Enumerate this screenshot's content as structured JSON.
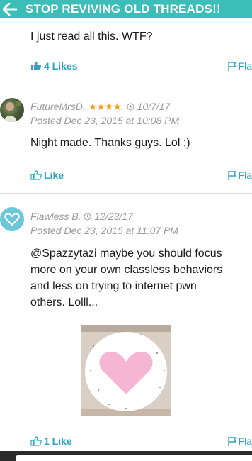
{
  "header": {
    "title": "STOP REVIVING OLD THREADS!!"
  },
  "post0": {
    "text": "I just read all this. WTF?",
    "like_label": "4 Likes",
    "flag_label": "Fla"
  },
  "post1": {
    "username": "FutureMrsD.",
    "stars": "★★★★",
    "date": "10/7/17",
    "posted": "Posted Dec 23, 2015 at 10:08 PM",
    "text": "Night made. Thanks guys. Lol :)",
    "like_label": "Like",
    "flag_label": "Fla"
  },
  "post2": {
    "username": "Flawless B.",
    "date": "12/23/17",
    "posted": "Posted Dec 23, 2015 at 11:07 PM",
    "text_lines": [
      "@Spazzytazi maybe you should focus",
      "more on your own classless behaviors",
      "and less on trying to internet pwn",
      "others. Lolll..."
    ],
    "like_label": "1 Like",
    "flag_label": "Fla"
  },
  "colors": {
    "accent": "#3dbdb8",
    "link": "#2aa5c4",
    "stars": "#f3a21b",
    "heart": "#f4b6d2"
  },
  "icons": [
    "back-arrow-icon",
    "thumbs-up-icon",
    "flag-icon",
    "clock-icon",
    "heart-icon"
  ]
}
